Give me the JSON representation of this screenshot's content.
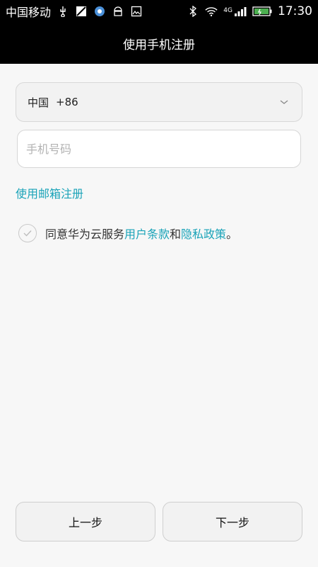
{
  "status_bar": {
    "carrier": "中国移动",
    "icons": [
      "usb-icon",
      "image-icon",
      "browser-icon",
      "android-icon",
      "gallery-icon"
    ],
    "right_icons": [
      "bluetooth-icon",
      "wifi-icon",
      "signal-icon",
      "battery-icon"
    ],
    "network": "4G",
    "time": "17:30"
  },
  "header": {
    "title": "使用手机注册"
  },
  "country": {
    "name": "中国",
    "code": "+86"
  },
  "phone": {
    "placeholder": "手机号码",
    "value": ""
  },
  "email_link": "使用邮箱注册",
  "agreement": {
    "prefix": "同意华为云服务",
    "user_terms": "用户条款",
    "middle": "和",
    "privacy": "隐私政策",
    "suffix": "。"
  },
  "buttons": {
    "prev": "上一步",
    "next": "下一步"
  },
  "colors": {
    "accent": "#1aa3b8",
    "header_bg": "#000000",
    "page_bg": "#f7f7f7"
  }
}
